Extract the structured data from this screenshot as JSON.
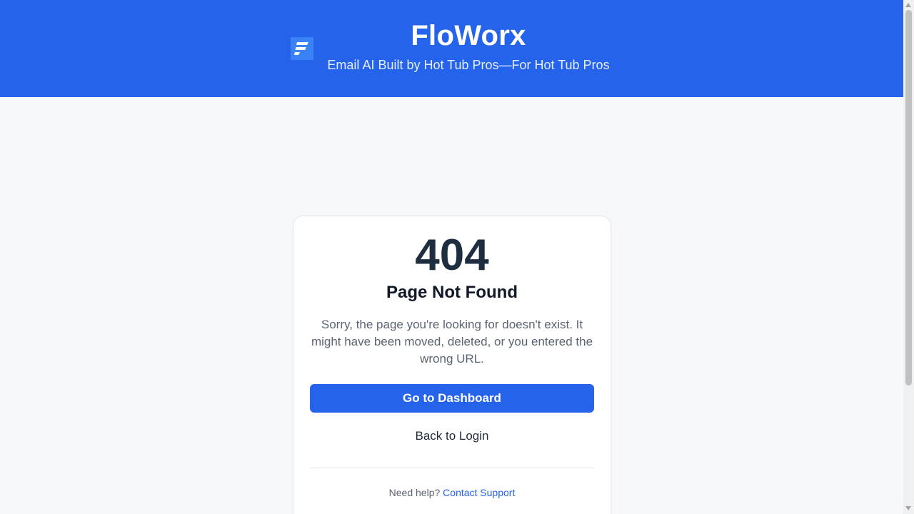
{
  "header": {
    "logo_icon": "floworx-logo-icon",
    "title": "FloWorx",
    "subtitle": "Email AI Built by Hot Tub Pros—For Hot Tub Pros",
    "background_color": "#2563eb"
  },
  "error_card": {
    "code": "404",
    "title": "Page Not Found",
    "message": "Sorry, the page you're looking for doesn't exist. It might have been moved, deleted, or you entered the wrong URL.",
    "primary_button_label": "Go to Dashboard",
    "secondary_link_label": "Back to Login",
    "help_text": "Need help?",
    "help_link_label": "Contact Support"
  },
  "colors": {
    "accent": "#2563eb",
    "page_background": "#f7f8fa",
    "code_text": "#1f2d40"
  }
}
